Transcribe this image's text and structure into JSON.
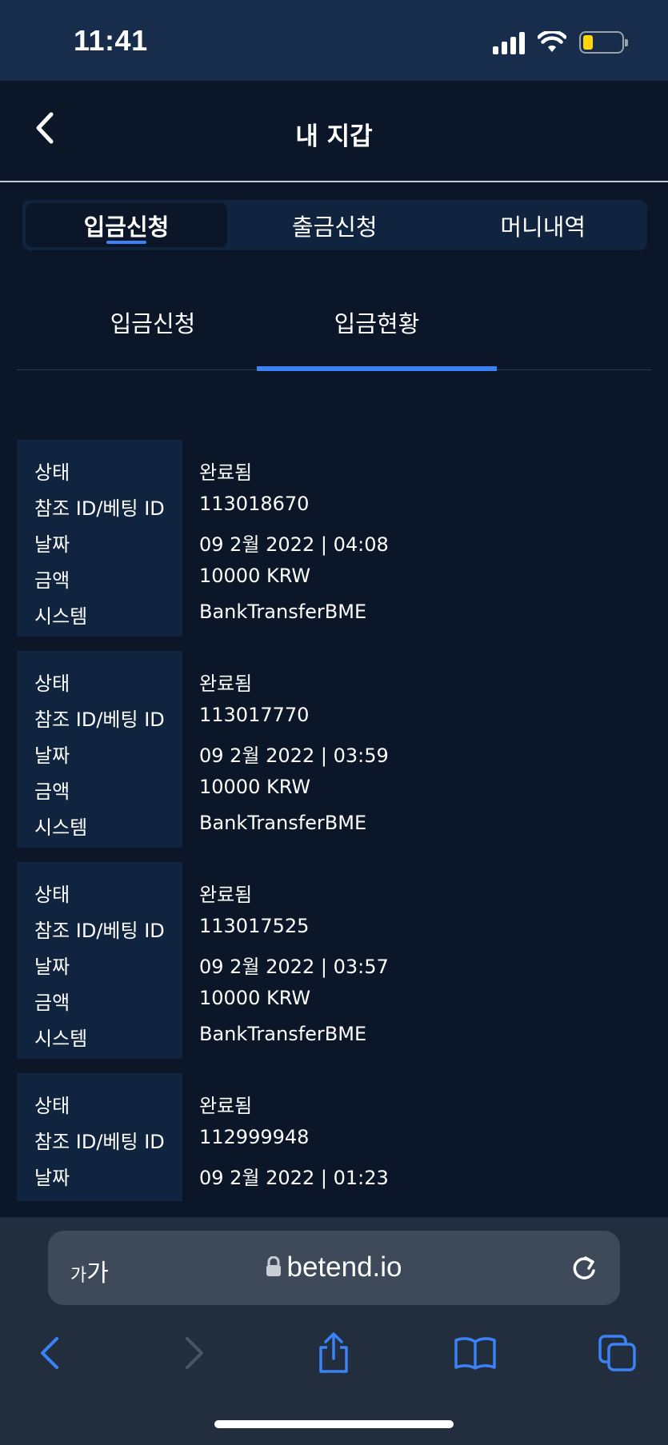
{
  "status_bar": {
    "time": "11:41",
    "battery_percent": 15
  },
  "header": {
    "title": "내 지갑"
  },
  "main_tabs": [
    {
      "label": "입금신청",
      "active": true
    },
    {
      "label": "출금신청",
      "active": false
    },
    {
      "label": "머니내역",
      "active": false
    }
  ],
  "sub_tabs": [
    {
      "label": "입금신청",
      "active": false
    },
    {
      "label": "입금현황",
      "active": true
    }
  ],
  "labels": {
    "status": "상태",
    "ref_id": "참조 ID/베팅 ID",
    "date": "날짜",
    "amount": "금액",
    "system": "시스템"
  },
  "records": [
    {
      "status": "완료됨",
      "ref_id": "113018670",
      "date": "09 2월 2022 | 04:08",
      "amount": "10000 KRW",
      "system": "BankTransferBME"
    },
    {
      "status": "완료됨",
      "ref_id": "113017770",
      "date": "09 2월 2022 | 03:59",
      "amount": "10000 KRW",
      "system": "BankTransferBME"
    },
    {
      "status": "완료됨",
      "ref_id": "113017525",
      "date": "09 2월 2022 | 03:57",
      "amount": "10000 KRW",
      "system": "BankTransferBME"
    },
    {
      "status": "완료됨",
      "ref_id": "112999948",
      "date": "09 2월 2022 | 01:23"
    }
  ],
  "browser": {
    "text_size_label_small": "가",
    "text_size_label_large": "가",
    "url": "betend.io"
  },
  "colors": {
    "background": "#0b1729",
    "panel": "#11243f",
    "accent": "#3b82f6",
    "status_bar": "#172d4b",
    "browser_bar": "#222e3e"
  }
}
